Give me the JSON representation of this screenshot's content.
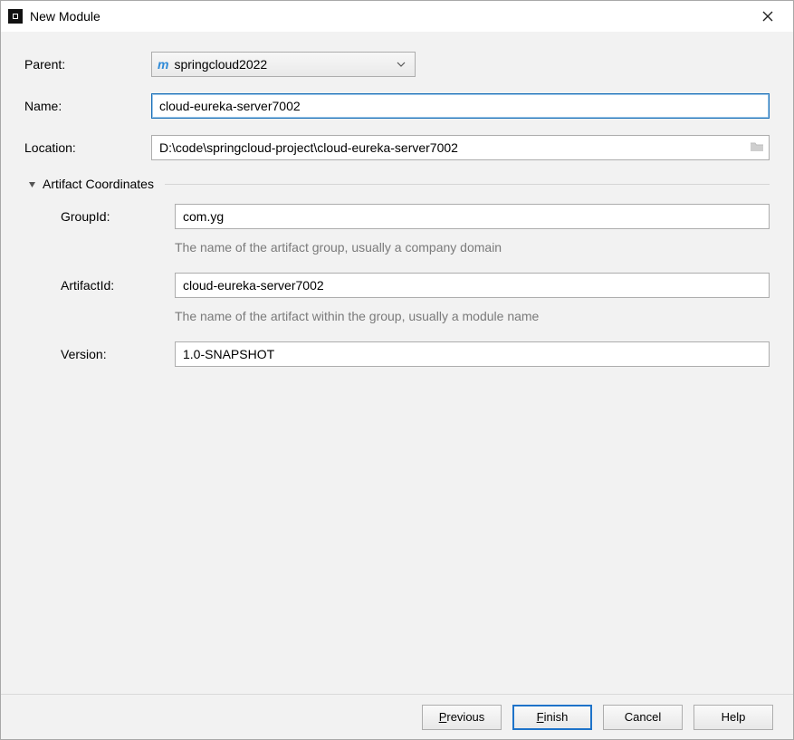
{
  "window": {
    "title": "New Module"
  },
  "form": {
    "parent_label": "Parent:",
    "parent_value": "springcloud2022",
    "name_label": "Name:",
    "name_value": "cloud-eureka-server7002",
    "location_label": "Location:",
    "location_value": "D:\\code\\springcloud-project\\cloud-eureka-server7002"
  },
  "artifact": {
    "section_title": "Artifact Coordinates",
    "group_label": "GroupId:",
    "group_value": "com.yg",
    "group_hint": "The name of the artifact group, usually a company domain",
    "artifact_label": "ArtifactId:",
    "artifact_value": "cloud-eureka-server7002",
    "artifact_hint": "The name of the artifact within the group, usually a module name",
    "version_label": "Version:",
    "version_value": "1.0-SNAPSHOT"
  },
  "buttons": {
    "previous": "Previous",
    "finish": "Finish",
    "cancel": "Cancel",
    "help": "Help"
  }
}
